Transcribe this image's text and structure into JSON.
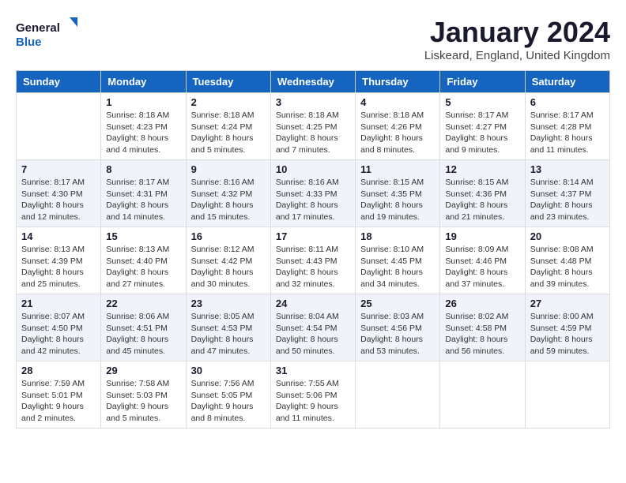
{
  "logo": {
    "line1": "General",
    "line2": "Blue"
  },
  "title": "January 2024",
  "location": "Liskeard, England, United Kingdom",
  "days_header": [
    "Sunday",
    "Monday",
    "Tuesday",
    "Wednesday",
    "Thursday",
    "Friday",
    "Saturday"
  ],
  "weeks": [
    [
      {
        "day": "",
        "sunrise": "",
        "sunset": "",
        "daylight": ""
      },
      {
        "day": "1",
        "sunrise": "Sunrise: 8:18 AM",
        "sunset": "Sunset: 4:23 PM",
        "daylight": "Daylight: 8 hours and 4 minutes."
      },
      {
        "day": "2",
        "sunrise": "Sunrise: 8:18 AM",
        "sunset": "Sunset: 4:24 PM",
        "daylight": "Daylight: 8 hours and 5 minutes."
      },
      {
        "day": "3",
        "sunrise": "Sunrise: 8:18 AM",
        "sunset": "Sunset: 4:25 PM",
        "daylight": "Daylight: 8 hours and 7 minutes."
      },
      {
        "day": "4",
        "sunrise": "Sunrise: 8:18 AM",
        "sunset": "Sunset: 4:26 PM",
        "daylight": "Daylight: 8 hours and 8 minutes."
      },
      {
        "day": "5",
        "sunrise": "Sunrise: 8:17 AM",
        "sunset": "Sunset: 4:27 PM",
        "daylight": "Daylight: 8 hours and 9 minutes."
      },
      {
        "day": "6",
        "sunrise": "Sunrise: 8:17 AM",
        "sunset": "Sunset: 4:28 PM",
        "daylight": "Daylight: 8 hours and 11 minutes."
      }
    ],
    [
      {
        "day": "7",
        "sunrise": "Sunrise: 8:17 AM",
        "sunset": "Sunset: 4:30 PM",
        "daylight": "Daylight: 8 hours and 12 minutes."
      },
      {
        "day": "8",
        "sunrise": "Sunrise: 8:17 AM",
        "sunset": "Sunset: 4:31 PM",
        "daylight": "Daylight: 8 hours and 14 minutes."
      },
      {
        "day": "9",
        "sunrise": "Sunrise: 8:16 AM",
        "sunset": "Sunset: 4:32 PM",
        "daylight": "Daylight: 8 hours and 15 minutes."
      },
      {
        "day": "10",
        "sunrise": "Sunrise: 8:16 AM",
        "sunset": "Sunset: 4:33 PM",
        "daylight": "Daylight: 8 hours and 17 minutes."
      },
      {
        "day": "11",
        "sunrise": "Sunrise: 8:15 AM",
        "sunset": "Sunset: 4:35 PM",
        "daylight": "Daylight: 8 hours and 19 minutes."
      },
      {
        "day": "12",
        "sunrise": "Sunrise: 8:15 AM",
        "sunset": "Sunset: 4:36 PM",
        "daylight": "Daylight: 8 hours and 21 minutes."
      },
      {
        "day": "13",
        "sunrise": "Sunrise: 8:14 AM",
        "sunset": "Sunset: 4:37 PM",
        "daylight": "Daylight: 8 hours and 23 minutes."
      }
    ],
    [
      {
        "day": "14",
        "sunrise": "Sunrise: 8:13 AM",
        "sunset": "Sunset: 4:39 PM",
        "daylight": "Daylight: 8 hours and 25 minutes."
      },
      {
        "day": "15",
        "sunrise": "Sunrise: 8:13 AM",
        "sunset": "Sunset: 4:40 PM",
        "daylight": "Daylight: 8 hours and 27 minutes."
      },
      {
        "day": "16",
        "sunrise": "Sunrise: 8:12 AM",
        "sunset": "Sunset: 4:42 PM",
        "daylight": "Daylight: 8 hours and 30 minutes."
      },
      {
        "day": "17",
        "sunrise": "Sunrise: 8:11 AM",
        "sunset": "Sunset: 4:43 PM",
        "daylight": "Daylight: 8 hours and 32 minutes."
      },
      {
        "day": "18",
        "sunrise": "Sunrise: 8:10 AM",
        "sunset": "Sunset: 4:45 PM",
        "daylight": "Daylight: 8 hours and 34 minutes."
      },
      {
        "day": "19",
        "sunrise": "Sunrise: 8:09 AM",
        "sunset": "Sunset: 4:46 PM",
        "daylight": "Daylight: 8 hours and 37 minutes."
      },
      {
        "day": "20",
        "sunrise": "Sunrise: 8:08 AM",
        "sunset": "Sunset: 4:48 PM",
        "daylight": "Daylight: 8 hours and 39 minutes."
      }
    ],
    [
      {
        "day": "21",
        "sunrise": "Sunrise: 8:07 AM",
        "sunset": "Sunset: 4:50 PM",
        "daylight": "Daylight: 8 hours and 42 minutes."
      },
      {
        "day": "22",
        "sunrise": "Sunrise: 8:06 AM",
        "sunset": "Sunset: 4:51 PM",
        "daylight": "Daylight: 8 hours and 45 minutes."
      },
      {
        "day": "23",
        "sunrise": "Sunrise: 8:05 AM",
        "sunset": "Sunset: 4:53 PM",
        "daylight": "Daylight: 8 hours and 47 minutes."
      },
      {
        "day": "24",
        "sunrise": "Sunrise: 8:04 AM",
        "sunset": "Sunset: 4:54 PM",
        "daylight": "Daylight: 8 hours and 50 minutes."
      },
      {
        "day": "25",
        "sunrise": "Sunrise: 8:03 AM",
        "sunset": "Sunset: 4:56 PM",
        "daylight": "Daylight: 8 hours and 53 minutes."
      },
      {
        "day": "26",
        "sunrise": "Sunrise: 8:02 AM",
        "sunset": "Sunset: 4:58 PM",
        "daylight": "Daylight: 8 hours and 56 minutes."
      },
      {
        "day": "27",
        "sunrise": "Sunrise: 8:00 AM",
        "sunset": "Sunset: 4:59 PM",
        "daylight": "Daylight: 8 hours and 59 minutes."
      }
    ],
    [
      {
        "day": "28",
        "sunrise": "Sunrise: 7:59 AM",
        "sunset": "Sunset: 5:01 PM",
        "daylight": "Daylight: 9 hours and 2 minutes."
      },
      {
        "day": "29",
        "sunrise": "Sunrise: 7:58 AM",
        "sunset": "Sunset: 5:03 PM",
        "daylight": "Daylight: 9 hours and 5 minutes."
      },
      {
        "day": "30",
        "sunrise": "Sunrise: 7:56 AM",
        "sunset": "Sunset: 5:05 PM",
        "daylight": "Daylight: 9 hours and 8 minutes."
      },
      {
        "day": "31",
        "sunrise": "Sunrise: 7:55 AM",
        "sunset": "Sunset: 5:06 PM",
        "daylight": "Daylight: 9 hours and 11 minutes."
      },
      {
        "day": "",
        "sunrise": "",
        "sunset": "",
        "daylight": ""
      },
      {
        "day": "",
        "sunrise": "",
        "sunset": "",
        "daylight": ""
      },
      {
        "day": "",
        "sunrise": "",
        "sunset": "",
        "daylight": ""
      }
    ]
  ]
}
